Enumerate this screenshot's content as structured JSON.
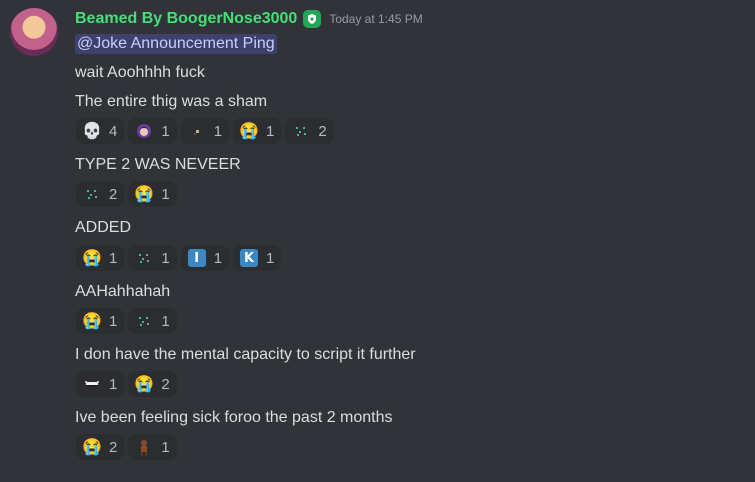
{
  "message": {
    "username": "Beamed By BoogerNose3000",
    "timestamp": "Today at 1:45 PM",
    "mention": "@Joke Announcement Ping",
    "lines": [
      "wait Aoohhhh fuck",
      "The entire thig was a sham",
      "TYPE 2 WAS NEVEER",
      "ADDED",
      "AAHahhahah",
      "I don have the mental capacity to script it further",
      "Ive been feeling sick foroo the past 2 months"
    ]
  },
  "reactions": {
    "row1": [
      {
        "emoji": "💀",
        "icon": "skull-icon",
        "count": "4"
      },
      {
        "emoji": "😈",
        "icon": "purple-character-icon",
        "count": "1"
      },
      {
        "emoji": "·",
        "icon": "tiny-bug-icon",
        "count": "1"
      },
      {
        "emoji": "😭",
        "icon": "loudly-crying-icon",
        "count": "1"
      },
      {
        "emoji": "⁘",
        "icon": "green-sparkle-icon",
        "count": "2"
      }
    ],
    "row2": [
      {
        "emoji": "⁘",
        "icon": "green-sparkle-icon",
        "count": "2"
      },
      {
        "emoji": "😭",
        "icon": "loudly-crying-icon",
        "count": "1"
      }
    ],
    "row3": [
      {
        "emoji": "😭",
        "icon": "loudly-crying-icon",
        "count": "1"
      },
      {
        "emoji": "⁘",
        "icon": "green-sparkle-icon",
        "count": "1"
      },
      {
        "emoji": "I",
        "icon": "regional-indicator-i-icon",
        "count": "1"
      },
      {
        "emoji": "K",
        "icon": "regional-indicator-k-icon",
        "count": "1"
      }
    ],
    "row4": [
      {
        "emoji": "😭",
        "icon": "loudly-crying-icon",
        "count": "1"
      },
      {
        "emoji": "⁘",
        "icon": "green-sparkle-icon",
        "count": "1"
      }
    ],
    "row5": [
      {
        "emoji": "▬",
        "icon": "grimace-face-icon",
        "count": "1"
      },
      {
        "emoji": "😭",
        "icon": "loudly-crying-icon",
        "count": "2"
      }
    ],
    "row6": [
      {
        "emoji": "😭",
        "icon": "loudly-crying-icon",
        "count": "2"
      },
      {
        "emoji": "🧍",
        "icon": "brown-figure-icon",
        "count": "1"
      }
    ]
  },
  "colors": {
    "background": "#313338",
    "username": "#43e07a",
    "mention_bg": "#5865f2",
    "reaction_bg": "#2b2d31",
    "regional_indicator": "#3b88c3"
  }
}
